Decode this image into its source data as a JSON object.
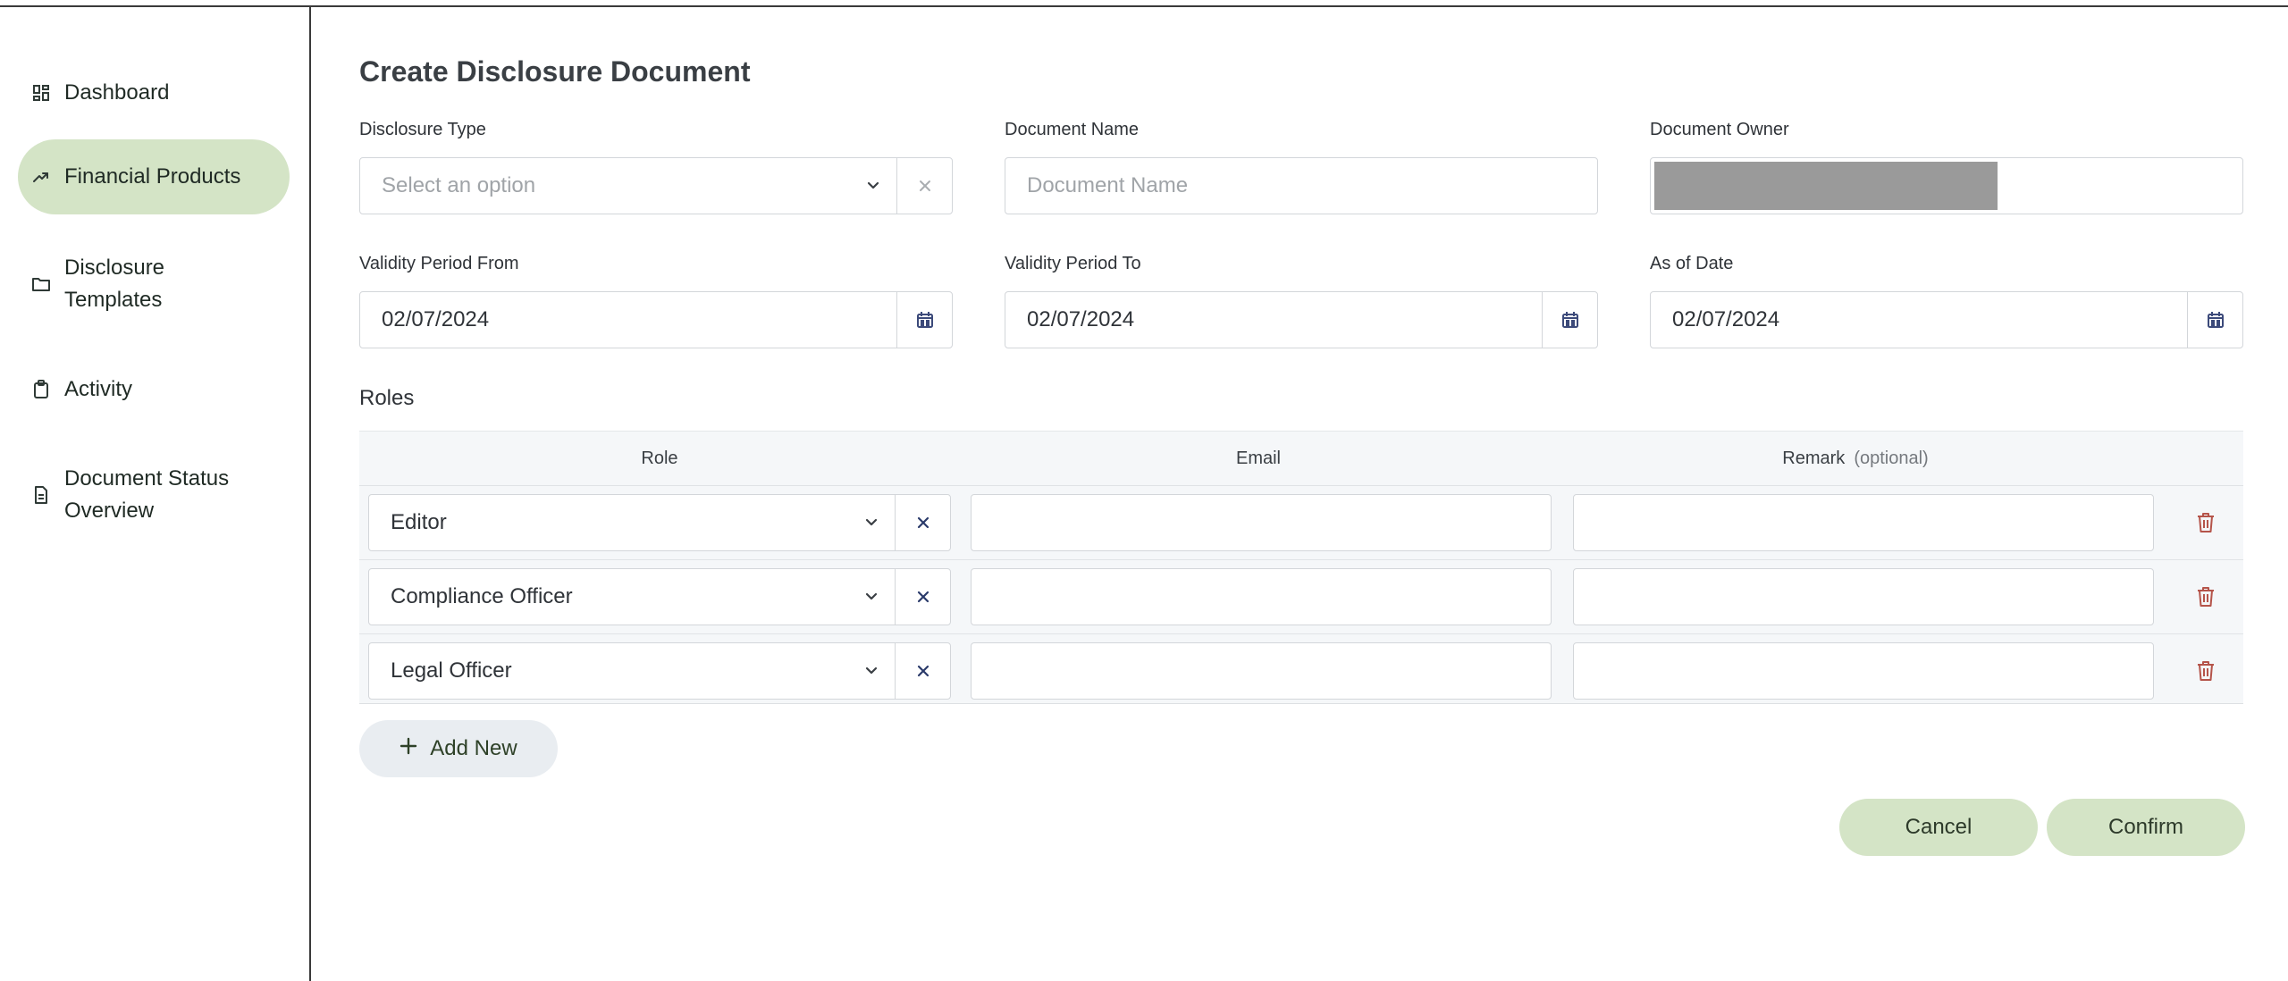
{
  "sidebar": {
    "items": [
      {
        "label": "Dashboard",
        "icon": "dashboard-icon",
        "active": false
      },
      {
        "label": "Financial Products",
        "icon": "trending-up-icon",
        "active": true
      },
      {
        "label": "Disclosure Templates",
        "icon": "folder-icon",
        "active": false
      },
      {
        "label": "Activity",
        "icon": "clipboard-icon",
        "active": false
      },
      {
        "label": "Document Status Overview",
        "icon": "document-icon",
        "active": false
      }
    ]
  },
  "page": {
    "title": "Create Disclosure Document"
  },
  "form": {
    "disclosure_type": {
      "label": "Disclosure Type",
      "placeholder": "Select an option"
    },
    "document_name": {
      "label": "Document Name",
      "placeholder": "Document Name"
    },
    "document_owner": {
      "label": "Document Owner"
    },
    "validity_from": {
      "label": "Validity Period From",
      "value": "02/07/2024"
    },
    "validity_to": {
      "label": "Validity Period To",
      "value": "02/07/2024"
    },
    "as_of_date": {
      "label": "As of Date",
      "value": "02/07/2024"
    }
  },
  "roles": {
    "section_label": "Roles",
    "columns": {
      "role": "Role",
      "email": "Email",
      "remark": "Remark",
      "remark_hint": "(optional)"
    },
    "rows": [
      {
        "role": "Editor",
        "email": "",
        "remark": ""
      },
      {
        "role": "Compliance Officer",
        "email": "",
        "remark": ""
      },
      {
        "role": "Legal Officer",
        "email": "",
        "remark": ""
      }
    ],
    "add_label": "Add New"
  },
  "actions": {
    "cancel": "Cancel",
    "confirm": "Confirm"
  },
  "colors": {
    "accent": "#d4e4c6",
    "danger": "#b5544a",
    "table_bg": "#f5f7f9"
  }
}
